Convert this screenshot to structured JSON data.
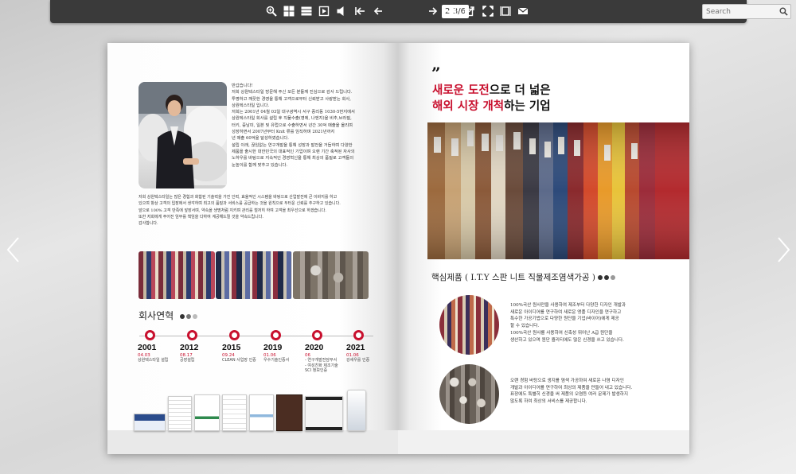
{
  "toolbar": {
    "page_indicator": "2-3/6",
    "search_placeholder": "Search",
    "buttons": [
      {
        "name": "zoom-icon"
      },
      {
        "name": "thumbnails-icon"
      },
      {
        "name": "table-of-contents-icon"
      },
      {
        "name": "autoplay-icon"
      },
      {
        "name": "sound-icon"
      },
      {
        "name": "first-page-icon"
      },
      {
        "name": "previous-page-icon"
      },
      {
        "name": "next-page-icon"
      },
      {
        "name": "last-page-icon"
      },
      {
        "name": "share-icon"
      },
      {
        "name": "fullscreen-icon"
      },
      {
        "name": "single-page-view-icon"
      },
      {
        "name": "email-icon"
      }
    ]
  },
  "left_page": {
    "greeting_lines": [
      "반갑습니다!",
      "저희 상원텍스타일 방문해 주신 모든 분들께 진심으로 감사 드립니다.",
      "투명하고 깨끗한 경영을 통해 고객으로부터 신뢰받고 사랑받는 회사,",
      "상원텍스타일 입니다.",
      "저희는 2001년 04월 03일 대구광역시 서구 중리동 1030-5번지에서",
      "상원텍스타일 회사를 설립 후 직물수출(영에, 나엔지)을 비추,브라질,",
      "터키, 중남미, 일본 및 유럽으로 수출하면서 년간 30억 매출을 올리며",
      "성장하면서 2007년부터 Knit 류를 임직하며 2021년까지",
      "년 매출 60억을 달성하였습니다.",
      "설립 이래, 끊임없는 연구개발을 통해 성장과 발전을 거듭하며 다양한",
      "제품을 출시한 대한민국의 대표적인 기업이며 오랜 기간 축적된 자사의",
      "노하우를 바탕으로 지속적인 경영혁신을 통해 최상의 품질로 고객들의",
      "눈높이를 함께 맞추고 있습니다."
    ],
    "intro_lines": [
      "저희 상원텍스타일는 많은 경험과 화함된 기술력을 가진 인력, 효율적인 시스템을 바탕으로 산업발전에 큰 이바지를 하고",
      "있으며 항상 고객의 입장에서 생각하며 최고의 품질과 서비스를 공급하는 것을 원칙으로 두터운 신뢰를 추구하고 있습니다.",
      "앞으로 100% 고객 만족에 앞장서며, 약속을 생명처럼 지키며 관리를 철저히 하여 고객을 최우선으로 하겠습니다.",
      "또한 저희에게 주어진 임무를 책임을 다하여 계공해드릴 것을 약속드립니다.",
      "감사합니다."
    ],
    "history_title": "회사연혁",
    "timeline": [
      {
        "year": "2001",
        "date": "04.03",
        "desc": [
          "상원텍스타일 설립"
        ]
      },
      {
        "year": "2012",
        "date": "08.17",
        "desc": [
          "공장설립"
        ]
      },
      {
        "year": "2015",
        "date": "09.24",
        "desc": [
          "CLEAN 사업장 인증"
        ]
      },
      {
        "year": "2019",
        "date": "01.06",
        "desc": [
          "우수기술인증서"
        ]
      },
      {
        "year": "2020",
        "date": "06",
        "desc": [
          "- 연구개발전담부서",
          "- 여성친화 제조기술",
          "SCI 정보인증"
        ]
      },
      {
        "year": "2021",
        "date": "01.06",
        "desc": [
          "강새우를 인증"
        ]
      }
    ]
  },
  "right_page": {
    "quote_mark": "”",
    "headline_line1_red": "새로운 도전",
    "headline_line1_rest": "으로 더 넓은",
    "headline_line2_red": "해외 시장 개척",
    "headline_line2_rest": "하는 기업",
    "products_title": "핵심제품 ( I.T.Y 스판 니트 직물제조염색가공 )",
    "product1_lines": [
      "100%국산 원사만을 사용하여 제조부터 다양한 디자인 개발과",
      "새로운 아이디어를 연구하여 새로운 앵플 디자인을 연구하고",
      "특수한 가공기법으로 다양한 원단을 기업(바이어)에게 제공",
      "할 수 있습니다.",
      "100%국산 원사를 사용하여 신축성 뛰어난 A급 원단을",
      "생산하고 있으며 원단 퀄리티에도 많은 신경을 쓰고 있습니다."
    ],
    "product2_lines": [
      "오랜 경험 바탕으로 생지를 염색 가공하여 새로운 나염 디자인",
      "개발과 아이디어를 연구하여 최상의 제품을 만들어 내고 있습니다.",
      "표장에도 특별히 신경을 써 제품의 오염등 여러 문제가 발생하지",
      "않도록 하여 최상의 서비스를 제공합니다."
    ]
  },
  "colors": {
    "accent_red": "#c8102e",
    "toolbar_bg": "#3a3a3a",
    "dot_dark": "#333333",
    "dot_mid": "#777777",
    "dot_light": "#bbbbbb"
  }
}
